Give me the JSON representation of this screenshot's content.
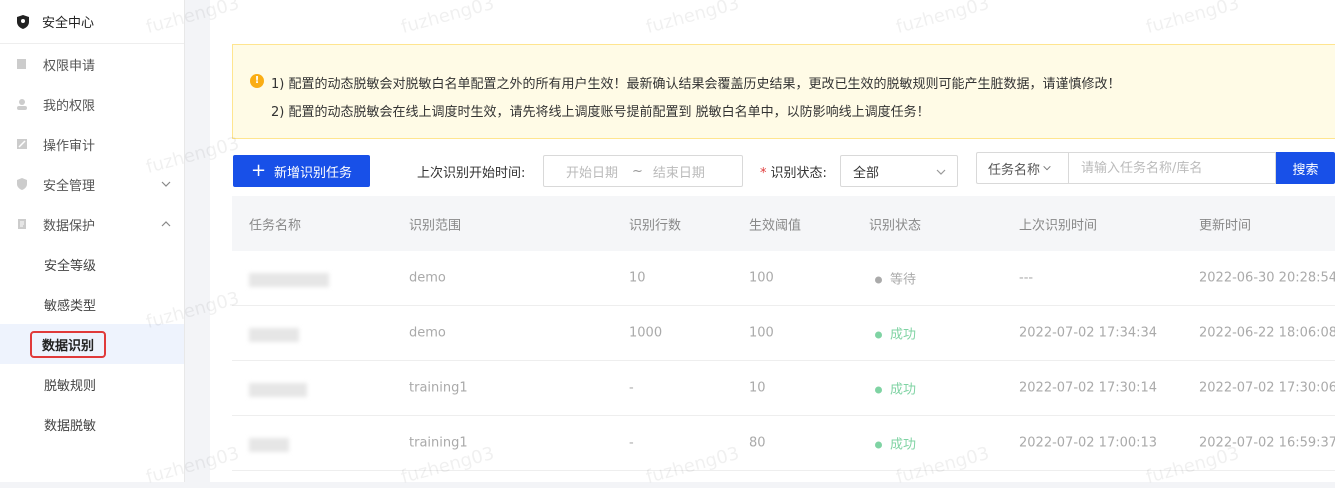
{
  "sidebar": {
    "header": "安全中心",
    "items": [
      {
        "label": "权限申请"
      },
      {
        "label": "我的权限"
      },
      {
        "label": "操作审计"
      },
      {
        "label": "安全管理"
      },
      {
        "label": "数据保护"
      }
    ],
    "sub_items": [
      {
        "label": "安全等级"
      },
      {
        "label": "敏感类型"
      },
      {
        "label": "数据识别"
      },
      {
        "label": "脱敏规则"
      },
      {
        "label": "数据脱敏"
      }
    ]
  },
  "notice": {
    "line1": "1) 配置的动态脱敏会对脱敏白名单配置之外的所有用户生效！最新确认结果会覆盖历史结果，更改已生效的脱敏规则可能产生脏数据，请谨慎修改！",
    "line2": "2) 配置的动态脱敏会在线上调度时生效，请先将线上调度账号提前配置到 脱敏白名单中，以防影响线上调度任务！"
  },
  "toolbar": {
    "new_task": "新增识别任务",
    "last_time_label": "上次识别开始时间:",
    "date_start": "开始日期",
    "date_sep": "~",
    "date_end": "结束日期",
    "status_label": "识别状态:",
    "status_value": "全部",
    "field_select": "任务名称",
    "search_placeholder": "请输入任务名称/库名",
    "search_button": "搜索"
  },
  "table": {
    "columns": [
      "任务名称",
      "识别范围",
      "识别行数",
      "生效阈值",
      "识别状态",
      "上次识别时间",
      "更新时间"
    ],
    "rows": [
      {
        "scope": "demo",
        "rows": "10",
        "threshold": "100",
        "status": "等待",
        "last": "---",
        "updated": "2022-06-30 20:28:54"
      },
      {
        "scope": "demo",
        "rows": "1000",
        "threshold": "100",
        "status": "成功",
        "last": "2022-07-02 17:34:34",
        "updated": "2022-06-22 18:06:08"
      },
      {
        "scope": "training1",
        "rows": "-",
        "threshold": "10",
        "status": "成功",
        "last": "2022-07-02 17:30:14",
        "updated": "2022-07-02 17:30:06"
      },
      {
        "scope": "training1",
        "rows": "-",
        "threshold": "80",
        "status": "成功",
        "last": "2022-07-02 17:00:13",
        "updated": "2022-07-02 16:59:37"
      }
    ]
  },
  "watermark": "fuzheng03",
  "colors": {
    "primary": "#1850e8",
    "success": "#7fd3a3",
    "warning": "#faad14",
    "highlight": "#e03a3a"
  }
}
